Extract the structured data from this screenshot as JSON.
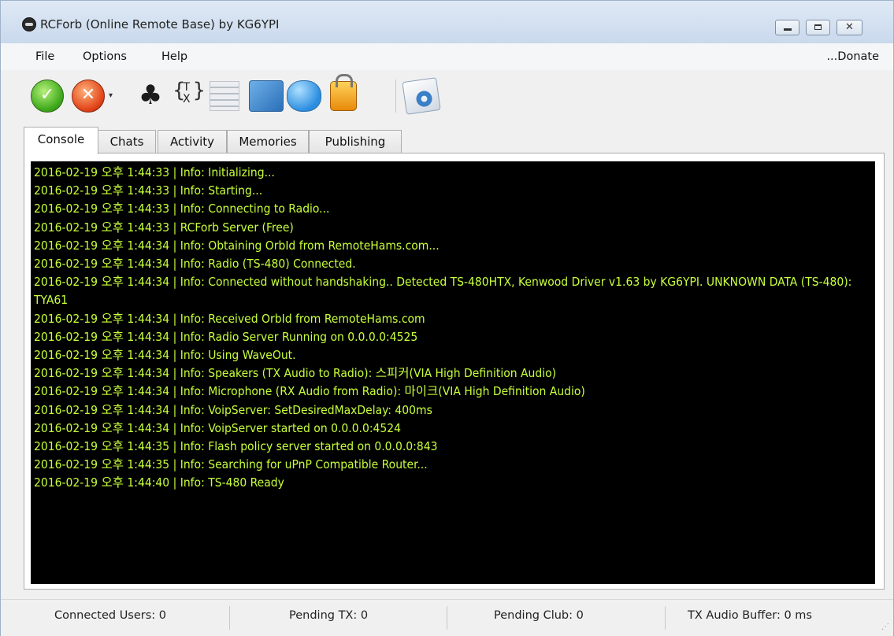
{
  "window": {
    "title": "RCForb (Online Remote Base) by KG6YPI",
    "minimize_glyph": "",
    "maximize_glyph": "",
    "close_glyph": "✕"
  },
  "menu": {
    "items": [
      "File",
      "Options",
      "Help"
    ],
    "donate": "...Donate"
  },
  "toolbar": {
    "icons": [
      "connect-ok-icon",
      "disconnect-stop-icon",
      "club-icon",
      "tx-icon",
      "grid-icon",
      "network-icon",
      "users-icon",
      "lock-icon",
      "settings-gear-icon"
    ],
    "tx_label": "T\nX",
    "dropdown_glyph": "▾"
  },
  "tabs": [
    "Console",
    "Chats",
    "Activity",
    "Memories",
    "Publishing"
  ],
  "active_tab": "Console",
  "console": {
    "lines": [
      "2016-02-19 오후 1:44:33 | Info: Initializing...",
      "2016-02-19 오후 1:44:33 | Info: Starting...",
      "2016-02-19 오후 1:44:33 | Info: Connecting to Radio...",
      "2016-02-19 오후 1:44:33 | RCForb Server (Free)",
      "2016-02-19 오후 1:44:34 | Info: Obtaining OrbId from RemoteHams.com...",
      "2016-02-19 오후 1:44:34 | Info: Radio (TS-480) Connected.",
      "2016-02-19 오후 1:44:34 | Info: Connected without handshaking.. Detected TS-480HTX, Kenwood Driver v1.63 by KG6YPI. UNKNOWN DATA (TS-480): TYA61",
      "2016-02-19 오후 1:44:34 | Info: Received OrbId from RemoteHams.com",
      "2016-02-19 오후 1:44:34 | Info: Radio Server Running on 0.0.0.0:4525",
      "2016-02-19 오후 1:44:34 | Info: Using WaveOut.",
      "2016-02-19 오후 1:44:34 | Info: Speakers (TX Audio to Radio): 스피커(VIA High Definition Audio)",
      "2016-02-19 오후 1:44:34 | Info: Microphone (RX Audio from Radio): 마이크(VIA High Definition Audio)",
      "2016-02-19 오후 1:44:34 | Info: VoipServer: SetDesiredMaxDelay: 400ms",
      "2016-02-19 오후 1:44:34 | Info: VoipServer started on 0.0.0.0:4524",
      "2016-02-19 오후 1:44:35 | Info: Flash policy server started on 0.0.0.0:843",
      "2016-02-19 오후 1:44:35 | Info: Searching for uPnP Compatible Router...",
      "2016-02-19 오후 1:44:40 | Info: TS-480 Ready"
    ]
  },
  "status": {
    "connected_users": "Connected Users: 0",
    "pending_tx": "Pending TX: 0",
    "pending_club": "Pending Club: 0",
    "tx_audio_buffer": "TX Audio Buffer: 0 ms"
  },
  "colors": {
    "console_bg": "#000000",
    "console_text": "#c8ff3a",
    "titlebar": "#d6e3f2"
  }
}
